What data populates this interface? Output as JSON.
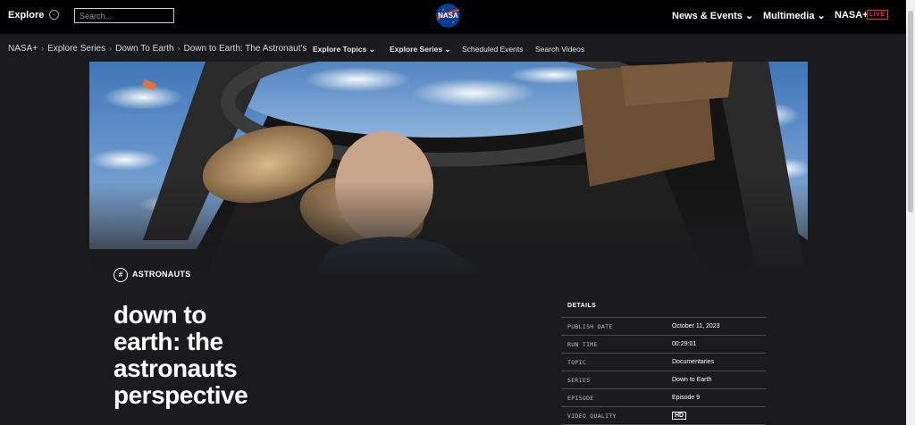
{
  "topbar": {
    "explore_label": "Explore",
    "search_placeholder": "Search...",
    "logo_text": "NASA",
    "news_label": "News & Events",
    "multimedia_label": "Multimedia",
    "nasaplus_label": "NASA+",
    "live_badge": "LIVE"
  },
  "breadcrumb": [
    "NASA+",
    "Explore Series",
    "Down To Earth",
    "Down to Earth: The Astronaut's Perspective"
  ],
  "subnav": {
    "explore_topics": "Explore Topics",
    "explore_series": "Explore Series",
    "scheduled_events": "Scheduled Events",
    "search_videos": "Search Videos"
  },
  "tag": "ASTRONAUTS",
  "title_lines": [
    "down to",
    "earth: the",
    "astronauts",
    "perspective"
  ],
  "details": {
    "heading": "DETAILS",
    "rows": [
      {
        "key": "PUBLISH DATE",
        "value": "October 11, 2023"
      },
      {
        "key": "RUN TIME",
        "value": "00:29:01"
      },
      {
        "key": "TOPIC",
        "value": "Documentaries"
      },
      {
        "key": "SERIES",
        "value": "Down to Earth"
      },
      {
        "key": "EPISODE",
        "value": "Episode 9"
      },
      {
        "key": "VIDEO QUALITY",
        "value": "HD"
      }
    ]
  },
  "colors": {
    "background": "#1b1b1e",
    "topbar": "#000000",
    "live": "#ee3333",
    "nasa_blue": "#0b3d91",
    "nasa_red": "#fc3d21"
  }
}
